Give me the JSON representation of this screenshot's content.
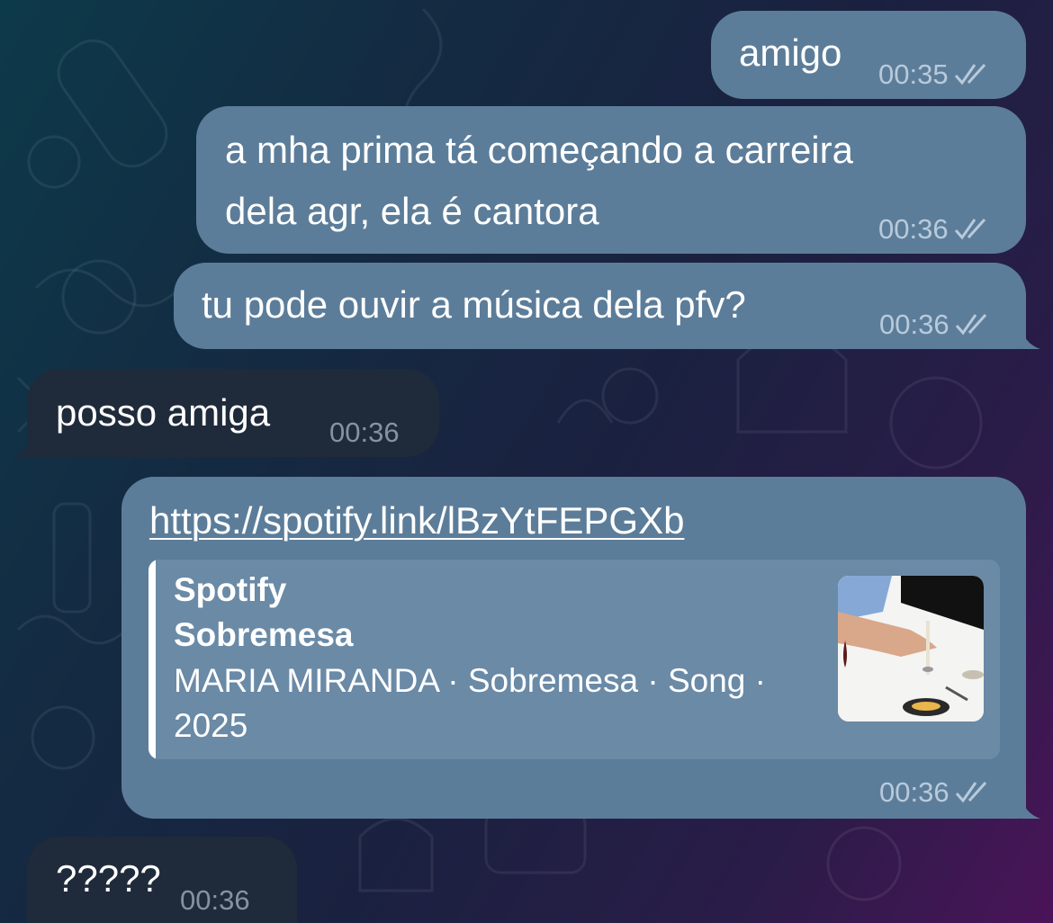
{
  "messages": [
    {
      "text": "amigo",
      "time": "00:35"
    },
    {
      "text_line1": "a mha prima tá começando a carreira",
      "text_line2": "dela agr, ela é cantora",
      "time": "00:36"
    },
    {
      "text": "tu pode ouvir a música dela pfv?",
      "time": "00:36"
    },
    {
      "text": "posso amiga",
      "time": "00:36"
    },
    {
      "link": "https://spotify.link/lBzYtFEPGXb",
      "preview": {
        "site": "Spotify",
        "title": "Sobremesa",
        "description": "MARIA MIRANDA · Sobremesa · Song · 2025"
      },
      "time": "00:36"
    },
    {
      "text": "?????",
      "time": "00:36"
    }
  ],
  "colors": {
    "outgoing_bubble": "#5c7d99",
    "incoming_bubble": "#1f2a3a",
    "preview_background": "#6a8aa6"
  },
  "icons": {
    "read_receipt": "double-check-icon",
    "thumbnail": "album-cover-image"
  }
}
